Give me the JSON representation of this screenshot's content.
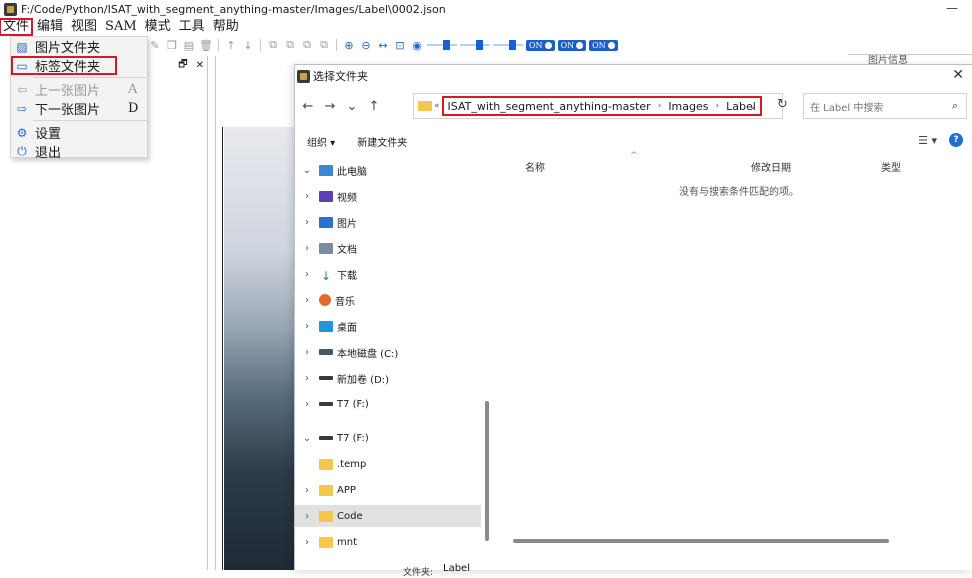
{
  "window": {
    "title": "F:/Code/Python/ISAT_with_segment_anything-master/Images/Label\\0002.json",
    "minimize": "—"
  },
  "menubar": [
    "文件",
    "编辑",
    "视图",
    "SAM",
    "模式",
    "工具",
    "帮助"
  ],
  "file_menu": {
    "items": [
      {
        "label": "图片文件夹",
        "icon": "image-folder-icon",
        "shortcut": "",
        "disabled": false
      },
      {
        "label": "标签文件夹",
        "icon": "label-folder-icon",
        "shortcut": "",
        "disabled": false
      },
      {
        "label": "上一张图片",
        "icon": "prev-icon",
        "shortcut": "A",
        "disabled": true
      },
      {
        "label": "下一张图片",
        "icon": "next-icon",
        "shortcut": "D",
        "disabled": false
      },
      {
        "label": "设置",
        "icon": "settings-icon",
        "shortcut": "",
        "disabled": false
      },
      {
        "label": "退出",
        "icon": "power-icon",
        "shortcut": "",
        "disabled": false
      }
    ]
  },
  "toolbar": {
    "toggles": [
      "ON",
      "ON",
      "ON"
    ]
  },
  "right_panel": {
    "label": "图片信息"
  },
  "dialog": {
    "title": "选择文件夹",
    "close": "✕",
    "address": {
      "parts": [
        "ISAT_with_segment_anything-master",
        "Images",
        "Label"
      ]
    },
    "search_placeholder": "在 Label 中搜索",
    "commands": {
      "organize": "组织 ▾",
      "new_folder": "新建文件夹"
    },
    "tree": [
      {
        "label": "此电脑",
        "icon": "pc-icon",
        "expanded": true
      },
      {
        "label": "视频",
        "icon": "video-icon"
      },
      {
        "label": "图片",
        "icon": "pictures-icon"
      },
      {
        "label": "文档",
        "icon": "documents-icon"
      },
      {
        "label": "下载",
        "icon": "download-icon"
      },
      {
        "label": "音乐",
        "icon": "music-icon"
      },
      {
        "label": "桌面",
        "icon": "desktop-icon"
      },
      {
        "label": "本地磁盘 (C:)",
        "icon": "disk-icon"
      },
      {
        "label": "新加卷 (D:)",
        "icon": "drive-icon"
      },
      {
        "label": "T7 (F:)",
        "icon": "drive-icon"
      },
      {
        "label": "T7 (F:)",
        "icon": "drive-icon",
        "expanded": true
      },
      {
        "label": ".temp",
        "icon": "folder-icon"
      },
      {
        "label": "APP",
        "icon": "folder-icon"
      },
      {
        "label": "Code",
        "icon": "folder-icon",
        "selected": true
      },
      {
        "label": "mnt",
        "icon": "folder-icon"
      }
    ],
    "columns": [
      "名称",
      "修改日期",
      "类型"
    ],
    "empty_message": "没有与搜索条件匹配的项。",
    "filename_label": "文件夹:",
    "filename_value": "Label"
  }
}
